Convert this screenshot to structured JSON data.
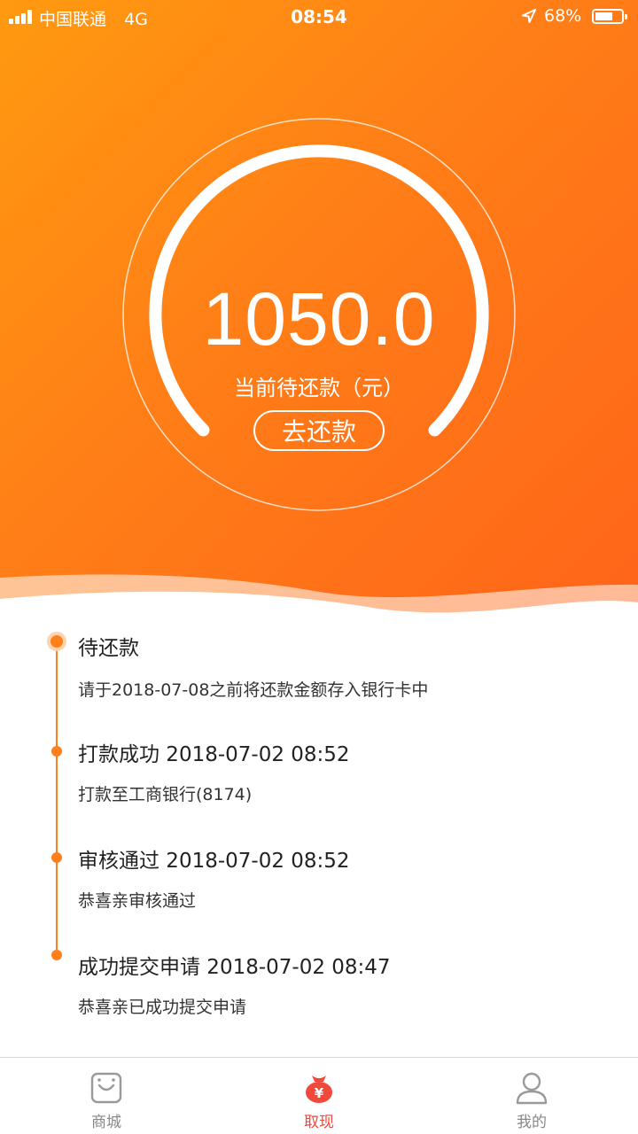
{
  "status_bar": {
    "carrier": "中国联通",
    "network": "4G",
    "time": "08:54",
    "battery": "68%",
    "battery_level": 0.68,
    "icons": [
      "signal-icon",
      "location-arrow-icon",
      "battery-icon"
    ]
  },
  "summary": {
    "amount": "1050.0",
    "label": "当前待还款（元）",
    "repay_button": "去还款"
  },
  "timeline": [
    {
      "title": "待还款",
      "desc": "请于2018-07-08之前将还款金额存入银行卡中"
    },
    {
      "title": "打款成功 2018-07-02 08:52",
      "desc": "打款至工商银行(8174)"
    },
    {
      "title": "审核通过 2018-07-02 08:52",
      "desc": "恭喜亲审核通过"
    },
    {
      "title": "成功提交申请 2018-07-02 08:47",
      "desc": "恭喜亲已成功提交申请"
    }
  ],
  "tab_bar": {
    "tabs": [
      {
        "label": "商城",
        "icon": "shopping-bag-icon"
      },
      {
        "label": "取现",
        "icon": "money-bag-icon"
      },
      {
        "label": "我的",
        "icon": "person-icon"
      }
    ],
    "active_index": 1
  },
  "colors": {
    "accent": "#ff7f1c",
    "gradient_start": "#ff9a10",
    "gradient_end": "#ff6419",
    "active_tab": "#f0483a"
  }
}
